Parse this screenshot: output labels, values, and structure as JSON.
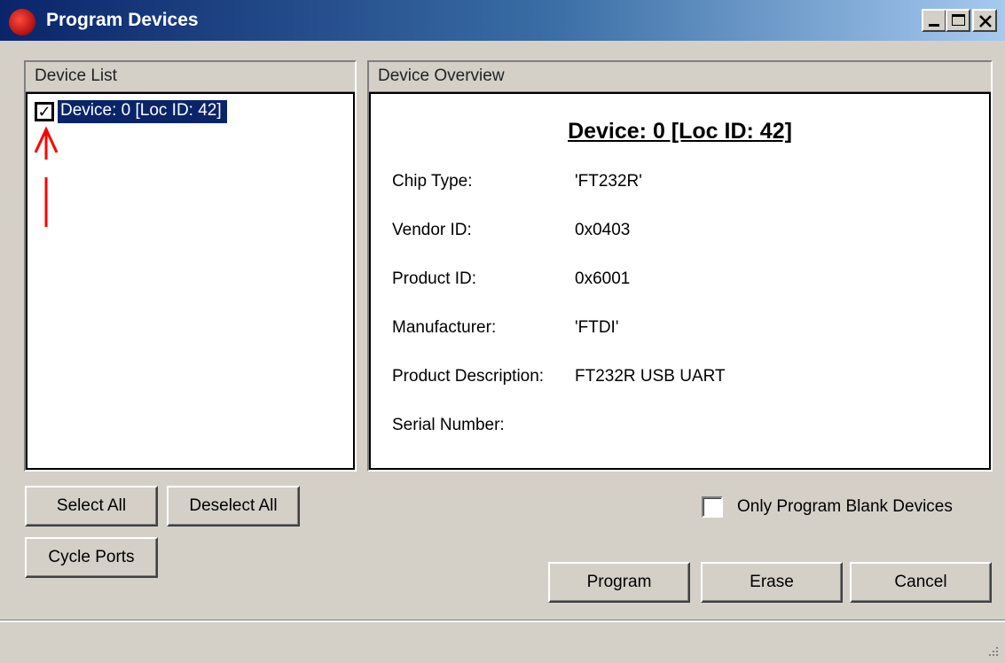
{
  "window": {
    "title": "Program Devices"
  },
  "device_list": {
    "header": "Device List",
    "items": [
      {
        "label": "Device: 0 [Loc ID: 42]",
        "checked": true,
        "check_glyph": "✓"
      }
    ]
  },
  "device_overview": {
    "header": "Device Overview",
    "title": "Device: 0 [Loc ID: 42]",
    "rows": [
      {
        "label": "Chip Type:",
        "value": "'FT232R'"
      },
      {
        "label": "Vendor ID:",
        "value": "0x0403"
      },
      {
        "label": "Product ID:",
        "value": "0x6001"
      },
      {
        "label": "Manufacturer:",
        "value": "'FTDI'"
      },
      {
        "label": "Product Description:",
        "value": "FT232R USB UART"
      },
      {
        "label": "Serial Number:",
        "value": ""
      }
    ]
  },
  "buttons": {
    "select_all": "Select All",
    "deselect_all": "Deselect All",
    "cycle_ports": "Cycle Ports",
    "program": "Program",
    "erase": "Erase",
    "cancel": "Cancel"
  },
  "options": {
    "only_program_blank": {
      "label": "Only Program Blank Devices",
      "checked": false
    }
  },
  "annotation": {
    "arrow_color": "#ff0000"
  },
  "colors": {
    "title_gradient_start": "#0a246a",
    "title_gradient_end": "#a6caf0",
    "selection": "#0a246a",
    "face": "#d4d0c8"
  }
}
